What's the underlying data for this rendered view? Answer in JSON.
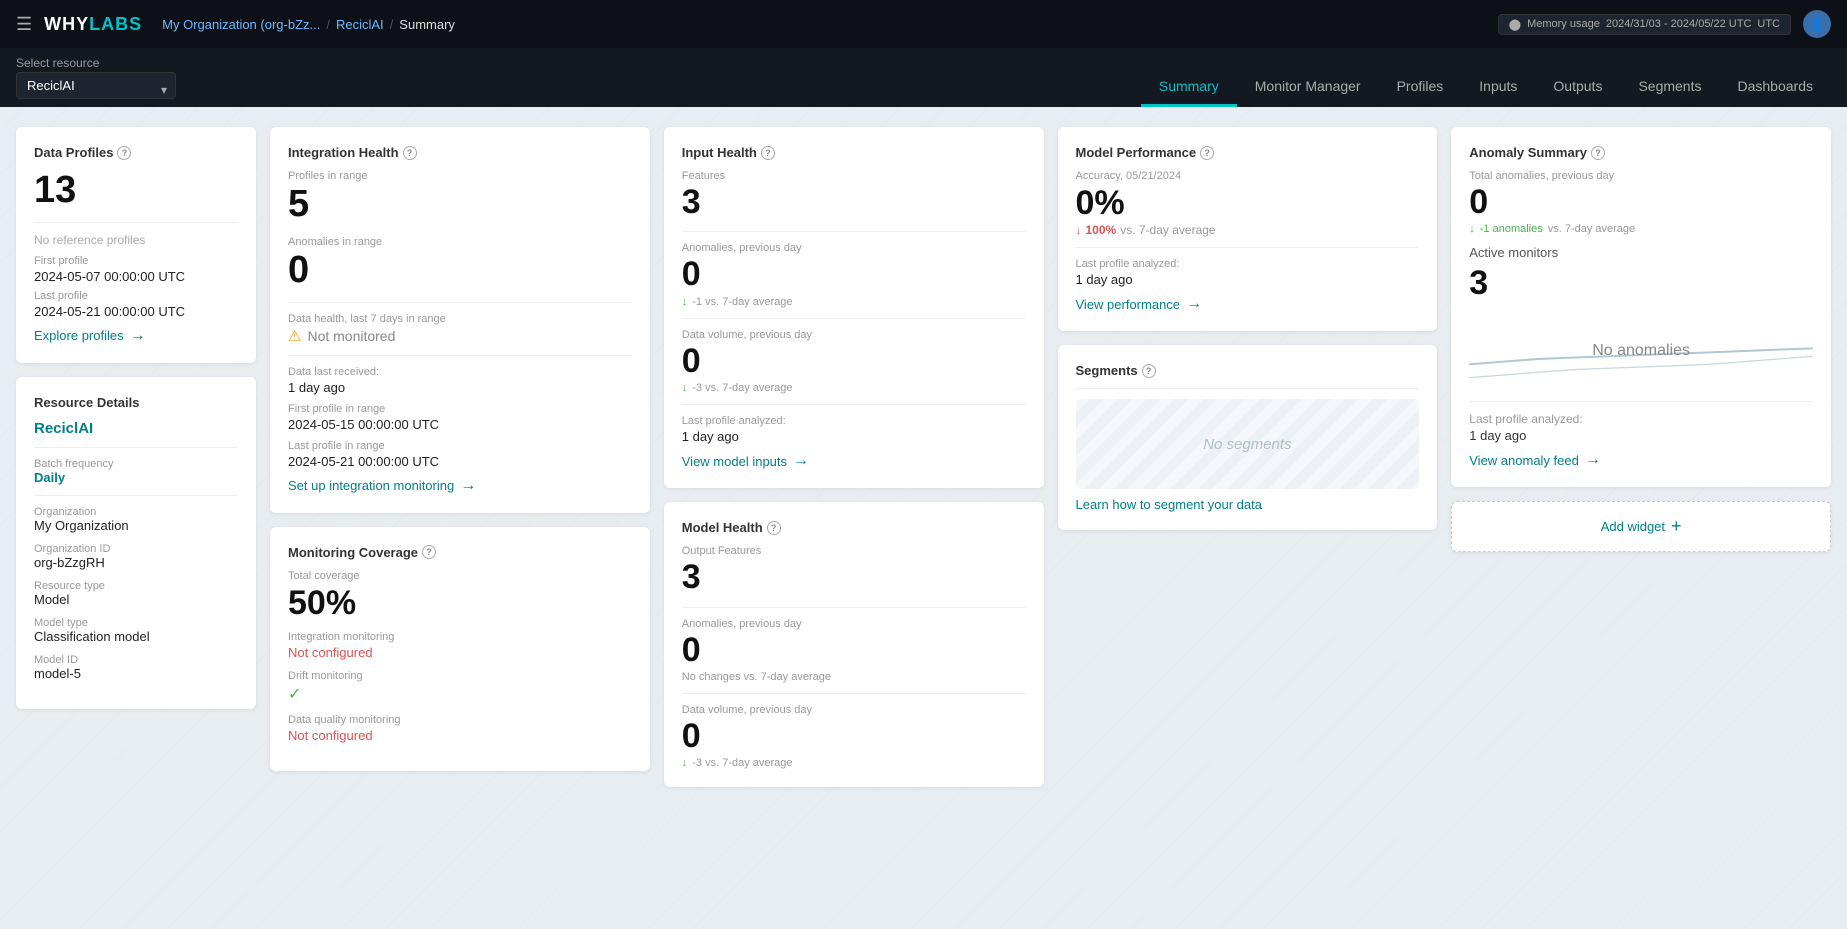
{
  "topNav": {
    "hamburger": "☰",
    "logo": "WHYLABS",
    "breadcrumb": {
      "org": "My Organization (org-bZz...",
      "orgHref": "#",
      "resource": "ReciclAI",
      "resourceHref": "#",
      "current": "Summary"
    },
    "memory": "Memory usage",
    "dateRange": "2024/31/03 - 2024/05/22 UTC",
    "avatarIcon": "👤"
  },
  "resourceBar": {
    "label": "Select resource",
    "selected": "ReciclAI",
    "options": [
      "ReciclAI"
    ]
  },
  "tabs": [
    {
      "id": "summary",
      "label": "Summary",
      "active": true
    },
    {
      "id": "monitor-manager",
      "label": "Monitor Manager",
      "active": false
    },
    {
      "id": "profiles",
      "label": "Profiles",
      "active": false
    },
    {
      "id": "inputs",
      "label": "Inputs",
      "active": false
    },
    {
      "id": "outputs",
      "label": "Outputs",
      "active": false
    },
    {
      "id": "segments",
      "label": "Segments",
      "active": false
    },
    {
      "id": "dashboards",
      "label": "Dashboards",
      "active": false
    }
  ],
  "dataProfiles": {
    "title": "Data Profiles",
    "count": "13",
    "noReference": "No reference profiles",
    "firstProfileLabel": "First profile",
    "firstProfileValue": "2024-05-07 00:00:00 UTC",
    "lastProfileLabel": "Last profile",
    "lastProfileValue": "2024-05-21 00:00:00 UTC",
    "linkText": "Explore profiles"
  },
  "resourceDetails": {
    "title": "Resource Details",
    "name": "ReciclAI",
    "batchFreqLabel": "Batch frequency",
    "batchFreqValue": "Daily",
    "orgLabel": "Organization",
    "orgValue": "My Organization",
    "orgIdLabel": "Organization ID",
    "orgIdValue": "org-bZzgRH",
    "resourceTypeLabel": "Resource type",
    "resourceTypeValue": "Model",
    "modelTypeLabel": "Model type",
    "modelTypeValue": "Classification model",
    "modelIdLabel": "Model ID",
    "modelIdValue": "model-5"
  },
  "integrationHealth": {
    "title": "Integration Health",
    "profilesInRangeLabel": "Profiles in range",
    "profilesInRange": "5",
    "anomaliesInRangeLabel": "Anomalies in range",
    "anomaliesInRange": "0",
    "dataHealthLabel": "Data health, last 7 days in range",
    "dataHealthStatus": "Not monitored",
    "dataLastReceivedLabel": "Data last received:",
    "dataLastReceived": "1 day ago",
    "firstProfileLabel": "First profile in range",
    "firstProfile": "2024-05-15 00:00:00 UTC",
    "lastProfileLabel": "Last profile in range",
    "lastProfile": "2024-05-21 00:00:00 UTC",
    "linkText": "Set up integration monitoring"
  },
  "monitoringCoverage": {
    "title": "Monitoring Coverage",
    "totalCoverageLabel": "Total coverage",
    "totalCoverageValue": "50%",
    "integrationMonitoringLabel": "Integration monitoring",
    "integrationMonitoringStatus": "Not configured",
    "driftMonitoringLabel": "Drift monitoring",
    "driftMonitoringStatus": "ok",
    "dataQualityLabel": "Data quality monitoring",
    "dataQualityStatus": "Not configured"
  },
  "inputHealth": {
    "title": "Input Health",
    "featuresLabel": "Features",
    "featuresValue": "3",
    "anomaliesPrevDayLabel": "Anomalies, previous day",
    "anomaliesPrevDayValue": "0",
    "anomaliesDelta": "-1 vs. 7-day average",
    "anomaliesDeltaDir": "down",
    "dataVolumePrevDayLabel": "Data volume, previous day",
    "dataVolumePrevDayValue": "0",
    "dataVolumeDelta": "-3 vs. 7-day average",
    "dataVolumeDeltaDir": "down",
    "lastProfileLabel": "Last profile analyzed:",
    "lastProfileValue": "1 day ago",
    "linkText": "View model inputs"
  },
  "modelHealth": {
    "title": "Model Health",
    "outputFeaturesLabel": "Output Features",
    "outputFeaturesValue": "3",
    "anomaliesPrevDayLabel": "Anomalies, previous day",
    "anomaliesPrevDayValue": "0",
    "anomaliesNote": "No changes vs. 7-day average",
    "dataVolumePrevDayLabel": "Data volume, previous day",
    "dataVolumePrevDayValue": "0",
    "dataVolumeDelta": "-3 vs. 7-day average",
    "dataVolumeDeltaDir": "down"
  },
  "modelPerformance": {
    "title": "Model Performance",
    "accuracyLabel": "Accuracy, 05/21/2024",
    "accuracyValue": "0%",
    "delta": "100%",
    "deltaLabel": "vs. 7-day average",
    "deltaDir": "down",
    "lastProfileLabel": "Last profile analyzed:",
    "lastProfileValue": "1 day ago",
    "linkText": "View performance"
  },
  "segments": {
    "title": "Segments",
    "noSegmentsText": "No segments",
    "linkText": "Learn how to segment your data"
  },
  "anomalySummary": {
    "title": "Anomaly Summary",
    "totalAnomaliesLabel": "Total anomalies, previous day",
    "totalAnomaliesValue": "0",
    "anomaliesDelta": "-1 anomalies",
    "anomaliesDeltaLabel": "vs. 7-day average",
    "activeMonitorsLabel": "Active monitors",
    "activeMonitorsValue": "3",
    "noAnomaliesText": "No anomalies",
    "lastProfileLabel": "Last profile analyzed:",
    "lastProfileValue": "1 day ago",
    "linkText": "View anomaly feed"
  },
  "addWidget": {
    "linkText": "Add widget"
  },
  "icons": {
    "help": "?",
    "arrow": "→",
    "warnTriangle": "⚠",
    "checkmark": "✓",
    "arrowDown": "↓",
    "plus": "+"
  }
}
